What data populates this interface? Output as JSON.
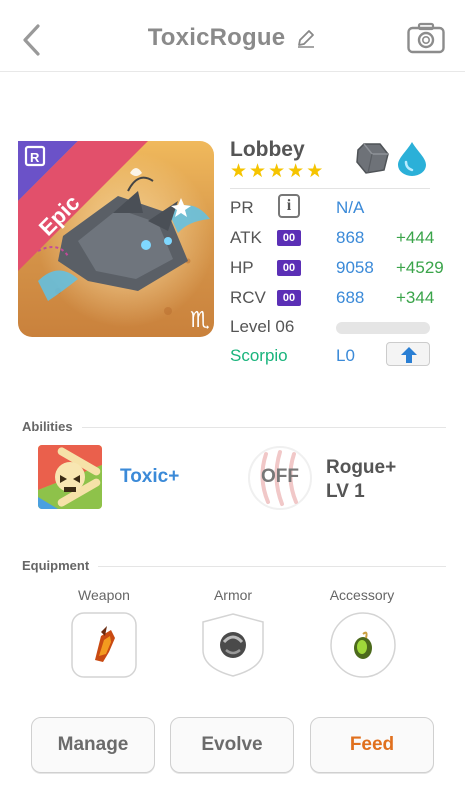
{
  "header": {
    "title": "ToxicRogue"
  },
  "monster": {
    "name": "Lobbey",
    "rarity": "Epic",
    "rarity_letter": "R",
    "stars": 5,
    "elements": [
      "stone-element-icon",
      "water-element-icon"
    ]
  },
  "stats": {
    "pr": {
      "label": "PR",
      "value": "N/A"
    },
    "atk": {
      "label": "ATK",
      "badge": "00",
      "value": "868",
      "bonus": "+444"
    },
    "hp": {
      "label": "HP",
      "badge": "00",
      "value": "9058",
      "bonus": "+4529"
    },
    "rcv": {
      "label": "RCV",
      "badge": "00",
      "value": "688",
      "bonus": "+344"
    },
    "level": {
      "label": "Level 06",
      "progress": 0.0
    },
    "sign": {
      "label": "Scorpio",
      "value": "L0"
    }
  },
  "abilities": {
    "title": "Abilities",
    "items": [
      {
        "name": "Toxic+",
        "state": ""
      },
      {
        "name_line1": "Rogue+",
        "name_line2": "LV 1",
        "state": "OFF"
      }
    ]
  },
  "equipment": {
    "title": "Equipment",
    "slots": [
      {
        "label": "Weapon"
      },
      {
        "label": "Armor"
      },
      {
        "label": "Accessory"
      }
    ]
  },
  "actions": {
    "manage": "Manage",
    "evolve": "Evolve",
    "feed": "Feed"
  },
  "colors": {
    "stat_value": "#3b8ad8",
    "stat_bonus": "#3aa44a",
    "badge": "#5b2fb6",
    "sign": "#19b47c",
    "feed": "#e0701e",
    "ability_link": "#3b8ad8"
  }
}
